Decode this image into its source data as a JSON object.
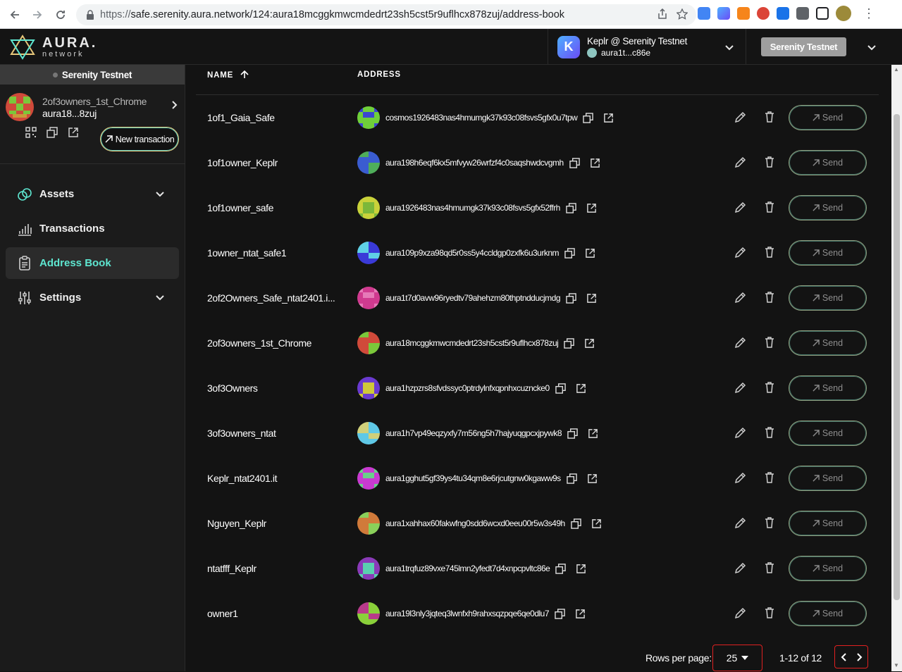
{
  "browser": {
    "url_proto": "https://",
    "url_rest": "safe.serenity.aura.network/124:aura18mcggkmwcmdedrt23sh5cst5r9uflhcx878zuj/address-book"
  },
  "header": {
    "logo_line1": "AURA.",
    "logo_line2": "network",
    "wallet_name": "Keplr @ Serenity Testnet",
    "wallet_addr": "aura1t...c86e",
    "network_badge": "Serenity Testnet"
  },
  "sidebar": {
    "network": "Serenity Testnet",
    "safe_name": "2of3owners_1st_Chrome",
    "safe_addr": "aura18...8zuj",
    "new_transaction": "New transaction",
    "items": [
      {
        "label": "Assets"
      },
      {
        "label": "Transactions"
      },
      {
        "label": "Address Book"
      },
      {
        "label": "Settings"
      }
    ]
  },
  "table": {
    "col_name": "NAME",
    "col_address": "ADDRESS",
    "send_label": "Send",
    "rows": [
      {
        "name": "1of1_Gaia_Safe",
        "address": "cosmos1926483nas4hmumgk37k93c08fsvs5gfx0u7tpw",
        "c1": "#6fcf3a",
        "c2": "#3b48d0"
      },
      {
        "name": "1of1owner_Keplr",
        "address": "aura198h6eqf6kx5mfvyw26wrfzf4c0saqshwdcvgmh",
        "c1": "#3a5cd0",
        "c2": "#4fae5a"
      },
      {
        "name": "1of1owner_safe",
        "address": "aura1926483nas4hmumgk37k93c08fsvs5gfx52ffrh",
        "c1": "#c9d23a",
        "c2": "#7bb83a"
      },
      {
        "name": "1owner_ntat_safe1",
        "address": "aura109p9xza98qd5r0ss5y4ccldgp0zxfk6u3urknm",
        "c1": "#3a3ad8",
        "c2": "#5fd0e6"
      },
      {
        "name": "2of2Owners_Safe_ntat2401.i...",
        "address": "aura1t7d0avw96ryedtv79ahehzm80thptndducjmdg",
        "c1": "#d03a8f",
        "c2": "#e67ab8"
      },
      {
        "name": "2of3owners_1st_Chrome",
        "address": "aura18mcggkmwcmdedrt23sh5cst5r9uflhcx878zuj",
        "c1": "#d04a3a",
        "c2": "#7bc83a"
      },
      {
        "name": "3of3Owners",
        "address": "aura1hzpzrs8sfvdssyc0ptrdylnfxqpnhxcuzncke0",
        "c1": "#6a3ad0",
        "c2": "#d0c83a"
      },
      {
        "name": "3of3owners_ntat",
        "address": "aura1h7vp49eqzyxfy7m56ng5h7hajyuqgpcxjpywk8",
        "c1": "#5fc8e6",
        "c2": "#d0d07a"
      },
      {
        "name": "Keplr_ntat2401.it",
        "address": "aura1gghut5gf39ys4tu34qm8e6rjcutgnw0kgaww9s",
        "c1": "#c83ad0",
        "c2": "#6ad08a"
      },
      {
        "name": "Nguyen_Keplr",
        "address": "aura1xahhax60fakwfng0sdd6wcxd0eeu00r5w3s49h",
        "c1": "#d07a3a",
        "c2": "#8ad05a"
      },
      {
        "name": "ntatfff_Keplr",
        "address": "aura1trqfuz89vxe745lmn2yfedt7d4xnpcpvltc86e",
        "c1": "#8a3ab8",
        "c2": "#5ad0b0"
      },
      {
        "name": "owner1",
        "address": "aura19l3nly3jqteq3lwnfxh9rahxsqzpqe6qe0dlu7",
        "c1": "#8ad03a",
        "c2": "#b83a8a"
      }
    ]
  },
  "pager": {
    "rows_per_page_label": "Rows per page:",
    "rows_per_page": "25",
    "page_info": "1-12 of 12"
  }
}
